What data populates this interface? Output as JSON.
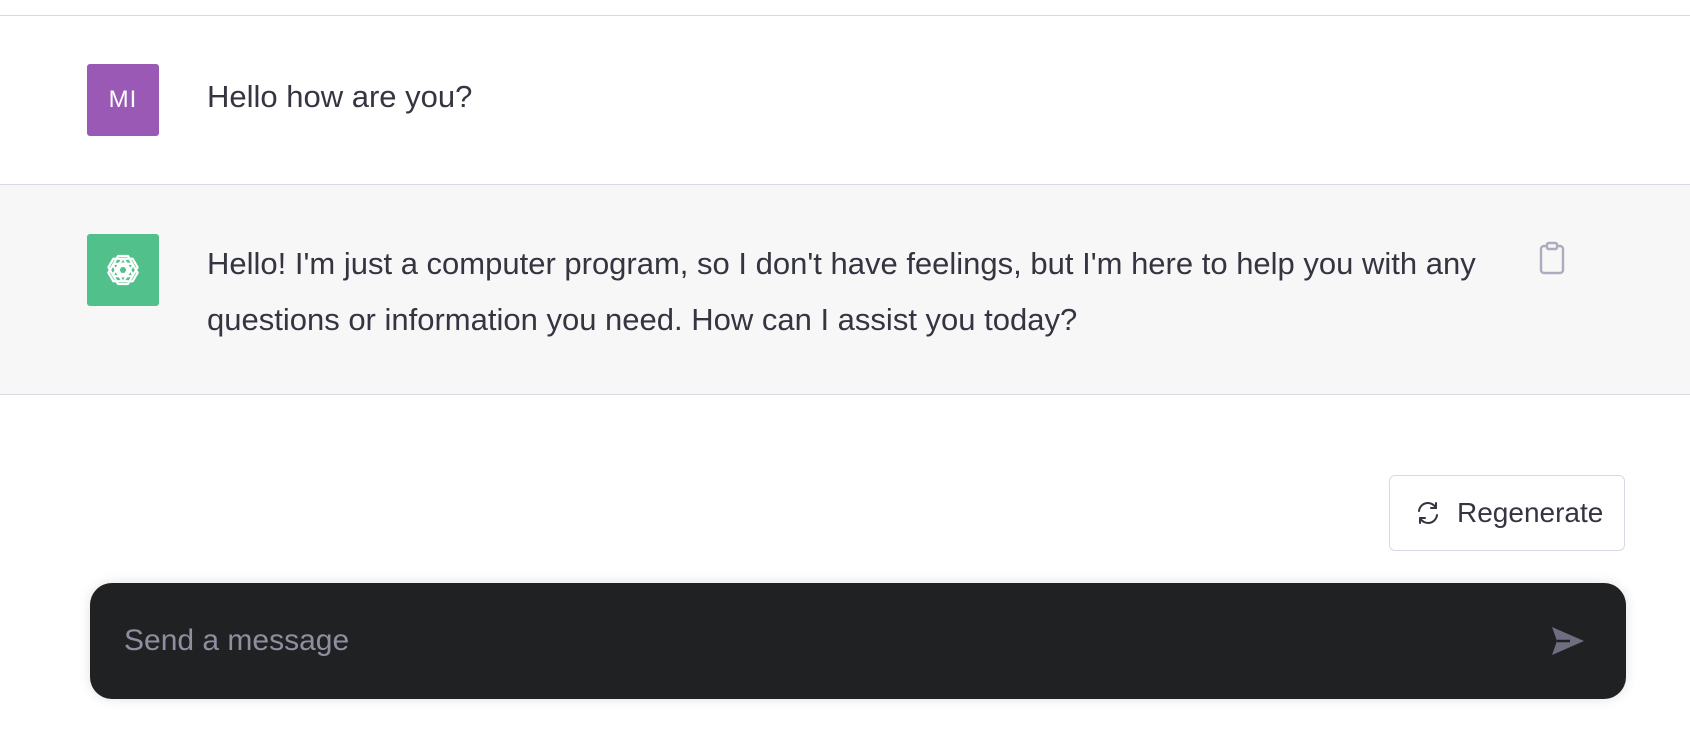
{
  "conversation": {
    "user_message": {
      "avatar_initials": "MI",
      "avatar_color": "#9b59b6",
      "text": "Hello how are you?"
    },
    "assistant_message": {
      "avatar_icon": "openai-logo-icon",
      "avatar_color": "#52c08a",
      "text": "Hello! I'm just a computer program, so I don't have feelings, but I'm here to help you with any questions or information you need. How can I assist you today?",
      "copy_icon": "clipboard-icon"
    }
  },
  "actions": {
    "regenerate_label": "Regenerate",
    "regenerate_icon": "refresh-icon"
  },
  "composer": {
    "placeholder": "Send a message",
    "value": "",
    "send_icon": "paper-plane-icon"
  },
  "colors": {
    "composer_background": "#202123",
    "assistant_row_background": "#f7f7f8",
    "text": "#343541"
  }
}
